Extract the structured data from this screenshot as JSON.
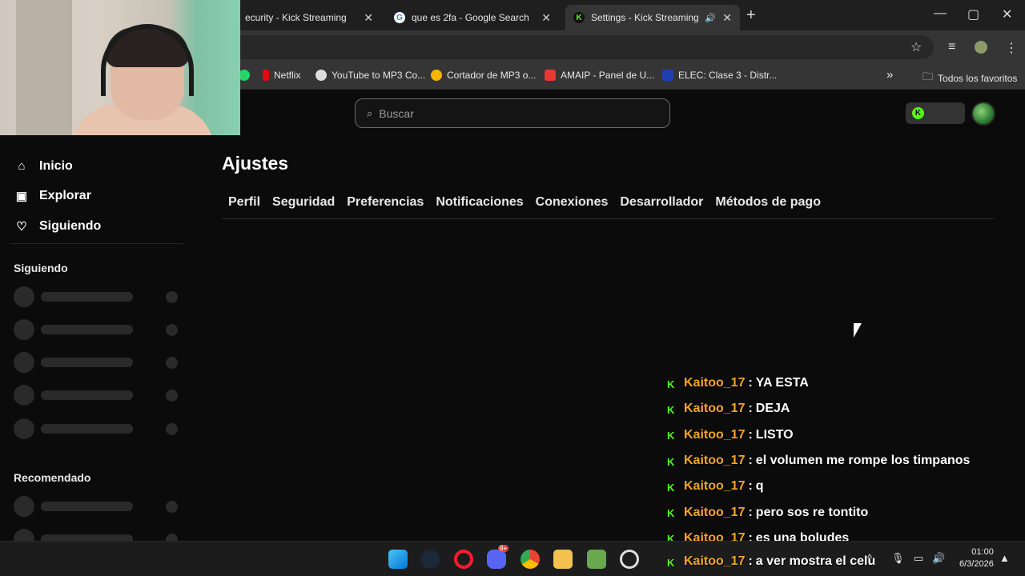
{
  "browser": {
    "tabs": [
      {
        "title": "ecurity - Kick Streaming",
        "favicon": "kick-icon"
      },
      {
        "title": "que es 2fa - Google Search",
        "favicon": "google-icon"
      },
      {
        "title": "Settings - Kick Streaming",
        "favicon": "kick-icon",
        "active": true,
        "audio": true
      }
    ],
    "new_tab": "+",
    "window_controls": [
      "—",
      "▢",
      "✕"
    ],
    "bookmarks": [
      {
        "label": "Netflix",
        "color": "#e50914"
      },
      {
        "label": "YouTube to MP3 Co...",
        "color": "#dddddd"
      },
      {
        "label": "Cortador de MP3 o...",
        "color": "#f4b400"
      },
      {
        "label": "AMAIP - Panel de U...",
        "color": "#e53935"
      },
      {
        "label": "ELEC: Clase 3 - Distr...",
        "color": "#1e40af"
      }
    ],
    "bookmarks_overflow": "»",
    "all_bookmarks": "Todos los favoritos"
  },
  "kick": {
    "search_placeholder": "Buscar",
    "nav": [
      {
        "label": "Inicio",
        "icon": "home-icon"
      },
      {
        "label": "Explorar",
        "icon": "explore-icon"
      },
      {
        "label": "Siguiendo",
        "icon": "heart-icon"
      }
    ],
    "following_title": "Siguiendo",
    "recommended_title": "Recomendado",
    "settings_title": "Ajustes",
    "settings_tabs": [
      "Perfil",
      "Seguridad",
      "Preferencias",
      "Notificaciones",
      "Conexiones",
      "Desarrollador",
      "Métodos de pago"
    ],
    "accent_color": "#53fc18"
  },
  "chat": [
    {
      "user": "Kaitoo_17",
      "msg": "YA ESTA"
    },
    {
      "user": "Kaitoo_17",
      "msg": "DEJA"
    },
    {
      "user": "Kaitoo_17",
      "msg": "LISTO"
    },
    {
      "user": "Kaitoo_17",
      "msg": "el volumen me rompe los timpanos"
    },
    {
      "user": "Kaitoo_17",
      "msg": "q"
    },
    {
      "user": "Kaitoo_17",
      "msg": "pero sos re tontito"
    },
    {
      "user": "Kaitoo_17",
      "msg": "es una boludes"
    },
    {
      "user": "Kaitoo_17",
      "msg": "a ver mostra el celu"
    }
  ],
  "taskbar": {
    "time": "01:00",
    "date": "6/3/2026",
    "discord_badge": "9+"
  }
}
